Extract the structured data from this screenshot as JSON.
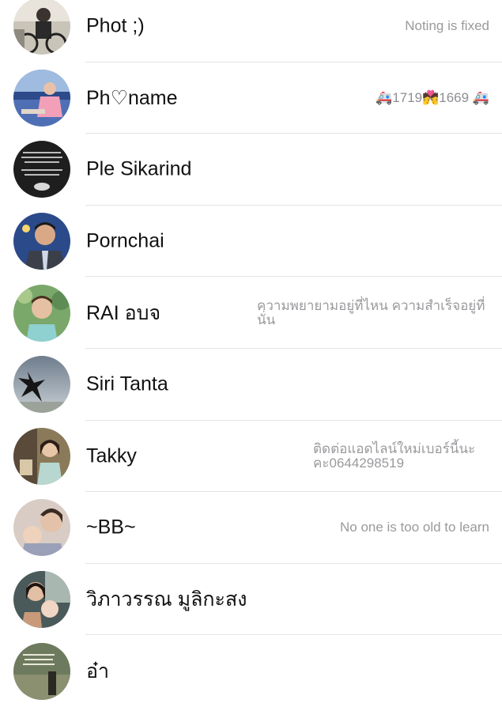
{
  "contacts": [
    {
      "name": "Phot ;)",
      "status": "Noting is fixed",
      "avatar": "avatar-man-bicycle"
    },
    {
      "name": "Ph♡name",
      "status": "🚑1719💏1669 🚑",
      "avatar": "avatar-woman-blue"
    },
    {
      "name": "Ple Sikarind",
      "status": "",
      "avatar": "avatar-dark-text-card"
    },
    {
      "name": "Pornchai",
      "status": "",
      "avatar": "avatar-man-suit"
    },
    {
      "name": "RAI อบจ",
      "status": "ความพยายามอยู่ที่ไหน ความสำเร็จอยู่ที่นั่น",
      "avatar": "avatar-woman-smile"
    },
    {
      "name": "Siri Tanta",
      "status": "",
      "avatar": "avatar-starfish-sky"
    },
    {
      "name": "Takky",
      "status": "ติดต่อแอดไลน์ใหม่เบอร์นี้นะคะ0644298519",
      "avatar": "avatar-woman-cafe"
    },
    {
      "name": "~BB~",
      "status": "No one is  too old to learn",
      "avatar": "avatar-mother-child"
    },
    {
      "name": "วิภาวรรณ มูลิกะสง",
      "status": "",
      "avatar": "avatar-mother-baby"
    },
    {
      "name": "อ๋า",
      "status": "",
      "avatar": "avatar-quote-card"
    }
  ]
}
